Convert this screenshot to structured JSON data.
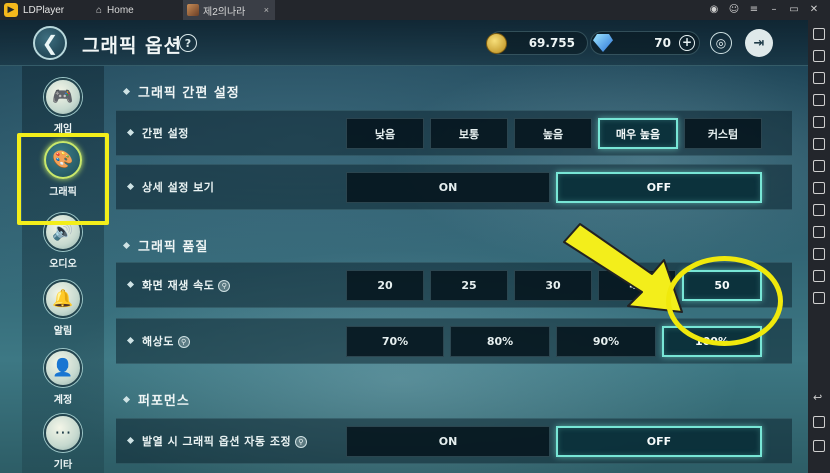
{
  "titlebar": {
    "app_name": "LDPlayer",
    "tabs": [
      {
        "label": "Home",
        "icon": "home-icon"
      },
      {
        "label": "제2의나라",
        "icon": "game-icon"
      }
    ],
    "close_tab": "×",
    "controls": [
      "gamepad-icon",
      "user-icon",
      "menu-icon",
      "minimize-icon",
      "restore-icon",
      "close-icon"
    ]
  },
  "header": {
    "title": "그래픽 옵션",
    "help": "?",
    "gold_value": "69.755",
    "gem_value": "70",
    "plus": "+"
  },
  "nav": {
    "items": [
      {
        "label": "게임",
        "icon": "gamepad-icon",
        "selected": false
      },
      {
        "label": "그래픽",
        "icon": "palette-icon",
        "selected": true
      },
      {
        "label": "오디오",
        "icon": "speaker-icon",
        "selected": false
      },
      {
        "label": "알림",
        "icon": "bell-icon",
        "selected": false
      },
      {
        "label": "계정",
        "icon": "person-icon",
        "selected": false
      },
      {
        "label": "기타",
        "icon": "more-icon",
        "selected": false
      }
    ]
  },
  "sections": {
    "quick": "그래픽 간편 설정",
    "quality": "그래픽 품질",
    "performance": "퍼포먼스"
  },
  "rows": {
    "preset": {
      "label": "간편 설정",
      "options": [
        "낮음",
        "보통",
        "높음",
        "매우 높음",
        "커스텀"
      ],
      "selected": "매우 높음"
    },
    "detail": {
      "label": "상세 설정 보기",
      "options": [
        "ON",
        "OFF"
      ],
      "selected": "OFF"
    },
    "fps": {
      "label": "화면 재생 속도",
      "options": [
        "20",
        "25",
        "30",
        "40",
        "50"
      ],
      "selected": "50"
    },
    "resolution": {
      "label": "해상도",
      "options": [
        "70%",
        "80%",
        "90%",
        "100%"
      ],
      "selected": "100%"
    },
    "heat": {
      "label": "발열 시 그래픽 옵션 자동 조정",
      "options": [
        "ON",
        "OFF"
      ],
      "selected": "OFF"
    }
  },
  "annotation_color": "#f3ee1b",
  "accent_color": "#78e6d6"
}
